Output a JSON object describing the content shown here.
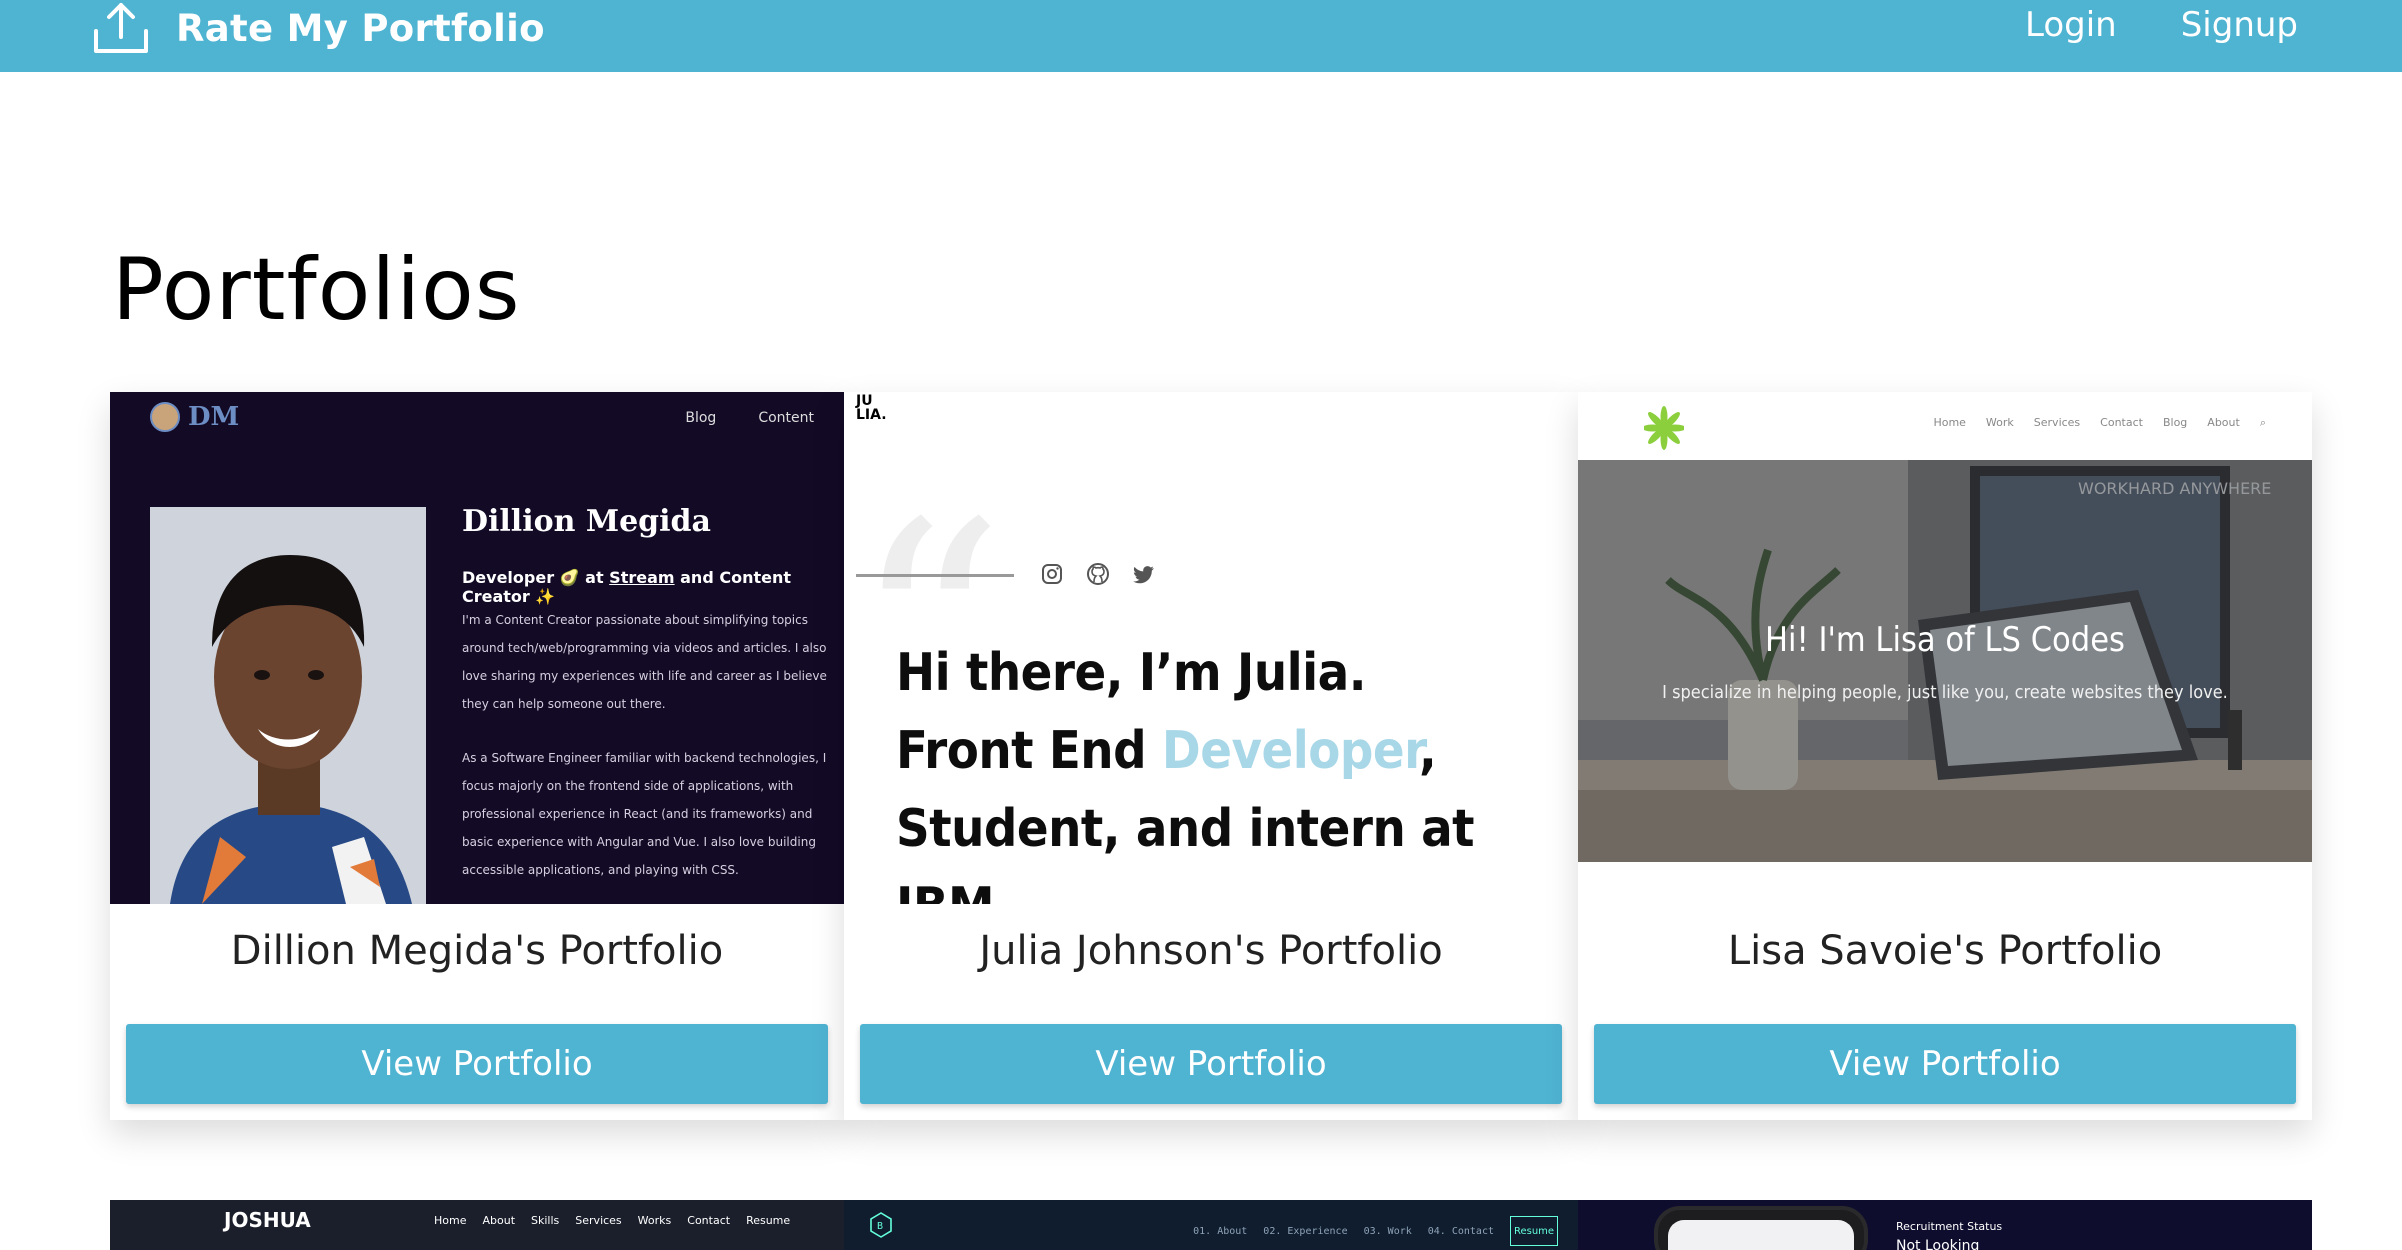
{
  "navbar": {
    "brand": "Rate My Portfolio",
    "icon": "upload-icon",
    "login": "Login",
    "signup": "Signup",
    "color": "#4fb3d2"
  },
  "page": {
    "title": "Portfolios"
  },
  "cards": [
    {
      "title": "Dillion Megida's Portfolio",
      "button": "View Portfolio",
      "preview": {
        "logo": "DM",
        "menu": [
          "Blog",
          "Content"
        ],
        "name": "Dillion Megida",
        "role_prefix": "Developer 🥑 at ",
        "role_link": "Stream",
        "role_suffix": " and Content Creator ✨",
        "para1": "I'm a Content Creator passionate about simplifying topics around tech/web/programming via videos and articles. I also love sharing my experiences with life and career as I believe they can help someone out there.",
        "para2": "As a Software Engineer familiar with backend technologies, I focus majorly on the frontend side of applications, with professional experience in React (and its frameworks) and basic experience with Angular and Vue. I also love building accessible applications, and playing with CSS."
      }
    },
    {
      "title": "Julia Johnson's Portfolio",
      "button": "View Portfolio",
      "preview": {
        "logo_line1": "JU",
        "logo_line2": "LIA.",
        "icons": [
          "instagram-icon",
          "github-icon",
          "twitter-icon"
        ],
        "hero_line1": "Hi there, I’m Julia.",
        "hero_line2_prefix": "Front End ",
        "hero_line2_highlight": "Developer",
        "hero_line2_suffix": ",",
        "hero_line3": "Student, and intern at IBM."
      }
    },
    {
      "title": "Lisa Savoie's Portfolio",
      "button": "View Portfolio",
      "preview": {
        "menu": [
          "Home",
          "Work",
          "Services",
          "Contact",
          "Blog",
          "About"
        ],
        "hero": "Hi! I'm Lisa of LS Codes",
        "sub": "I specialize in helping people, just like you, create websites they love.",
        "sign": "WORKHARD ANYWHERE"
      }
    }
  ],
  "row2": [
    {
      "logo": "JOSHUA",
      "menu": [
        "Home",
        "About",
        "Skills",
        "Services",
        "Works",
        "Contact",
        "Resume"
      ]
    },
    {
      "logo": "B",
      "menu": [
        "01. About",
        "02. Experience",
        "03. Work",
        "04. Contact"
      ],
      "resume": "Resume"
    },
    {
      "status_label": "Recruitment Status",
      "status_value": "Not Looking"
    }
  ]
}
